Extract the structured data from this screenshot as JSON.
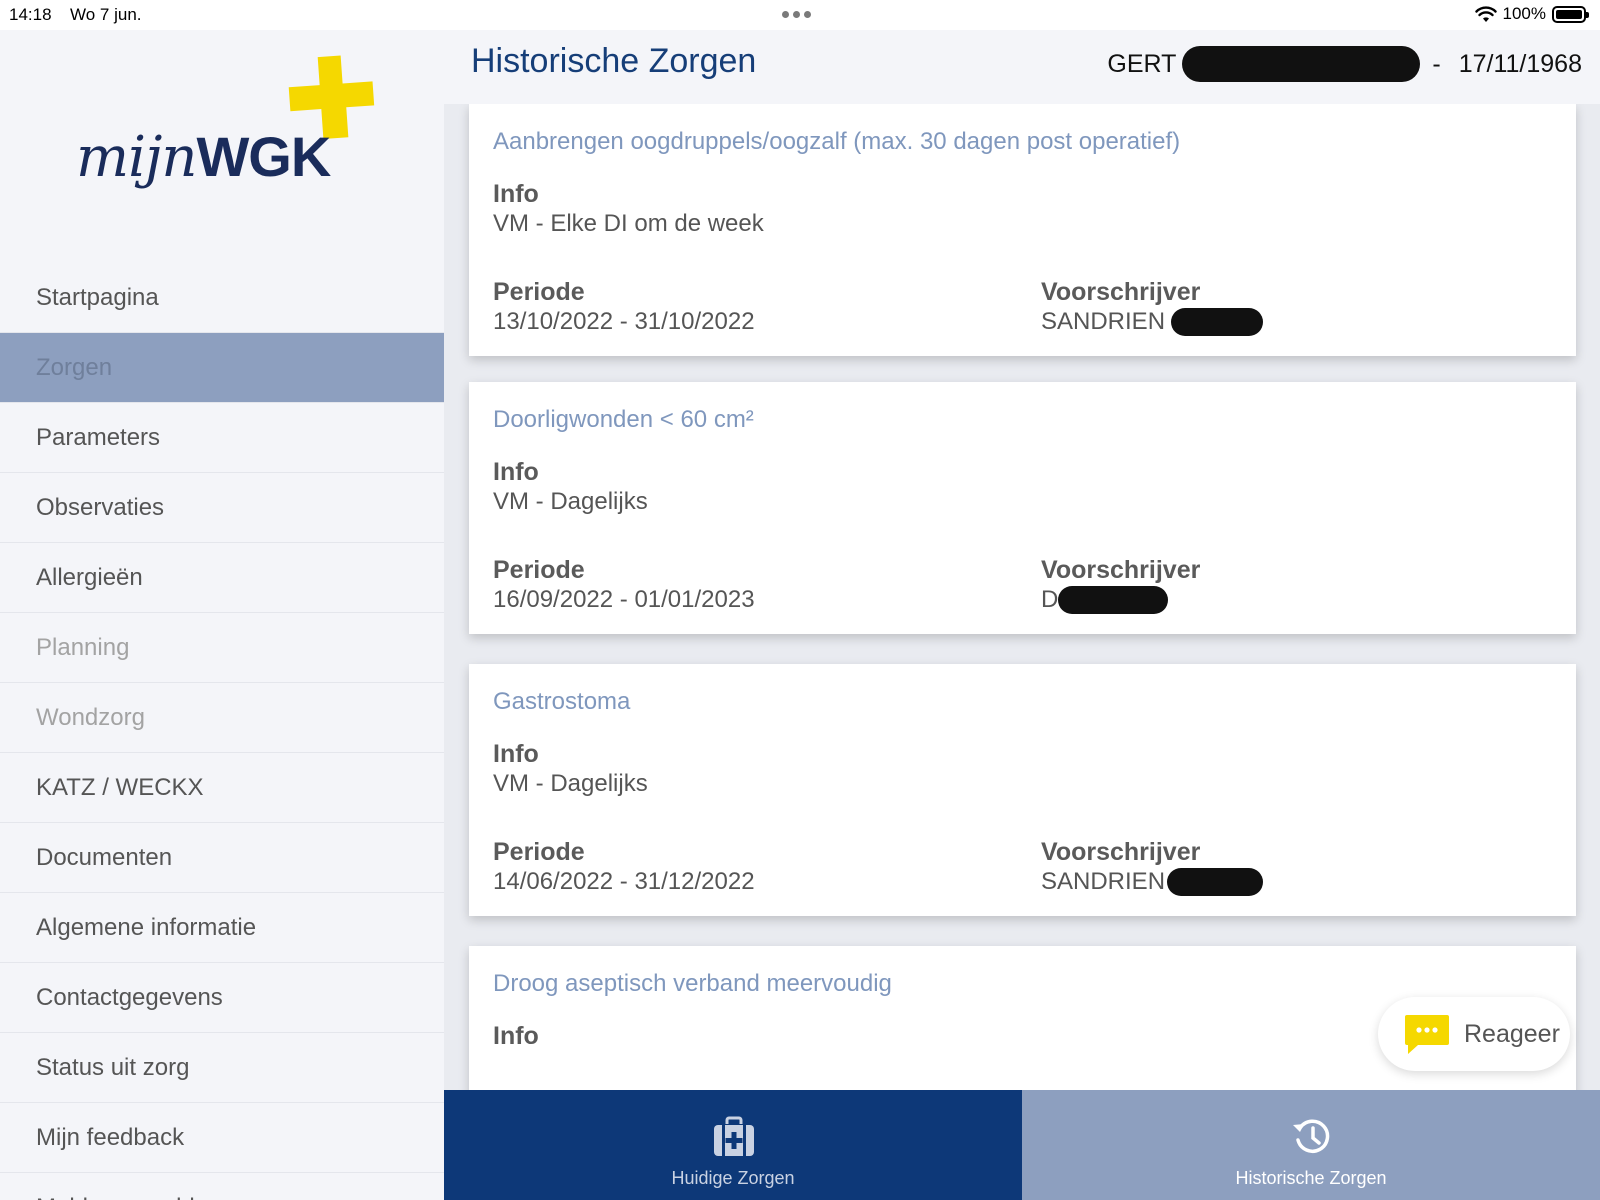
{
  "status_bar": {
    "time": "14:18",
    "date": "Wo 7 jun.",
    "battery": "100%"
  },
  "logo": {
    "part1": "mijn",
    "part2": "WGK",
    "cross_color": "#f5d800"
  },
  "sidebar": {
    "items": [
      {
        "label": "Startpagina",
        "state": "normal"
      },
      {
        "label": "Zorgen",
        "state": "active"
      },
      {
        "label": "Parameters",
        "state": "normal"
      },
      {
        "label": "Observaties",
        "state": "normal"
      },
      {
        "label": "Allergieën",
        "state": "normal"
      },
      {
        "label": "Planning",
        "state": "disabled"
      },
      {
        "label": "Wondzorg",
        "state": "disabled"
      },
      {
        "label": "KATZ / WECKX",
        "state": "normal"
      },
      {
        "label": "Documenten",
        "state": "normal"
      },
      {
        "label": "Algemene informatie",
        "state": "normal"
      },
      {
        "label": "Contactgegevens",
        "state": "normal"
      },
      {
        "label": "Status uit zorg",
        "state": "normal"
      },
      {
        "label": "Mijn feedback",
        "state": "normal"
      },
      {
        "label": "Meld een probleem",
        "state": "normal"
      }
    ]
  },
  "header": {
    "title": "Historische Zorgen",
    "patient_name": "GERT",
    "separator": "-",
    "patient_dob": "17/11/1968"
  },
  "labels": {
    "info": "Info",
    "periode": "Periode",
    "voorschrijver": "Voorschrijver"
  },
  "cards": [
    {
      "title": "Aanbrengen oogdruppels/oogzalf (max. 30 dagen post operatief)",
      "info": "VM - Elke DI om de week",
      "periode": "13/10/2022 - 31/10/2022",
      "voorschrijver": "SANDRIEN"
    },
    {
      "title": "Doorligwonden < 60 cm²",
      "info": "VM - Dagelijks",
      "periode": "16/09/2022 - 01/01/2023",
      "voorschrijver": "D"
    },
    {
      "title": "Gastrostoma",
      "info": "VM - Dagelijks",
      "periode": "14/06/2022 - 31/12/2022",
      "voorschrijver": "SANDRIEN"
    },
    {
      "title": "Droog aseptisch verband meervoudig"
    }
  ],
  "reply_button": {
    "label": "Reageer",
    "icon": "chat-bubble-icon",
    "icon_color": "#f5d800"
  },
  "tabs": [
    {
      "label": "Huidige Zorgen",
      "icon": "medical-kit-icon",
      "color": "#0d3878"
    },
    {
      "label": "Historische Zorgen",
      "icon": "history-icon",
      "color": "#8d9fbf"
    }
  ]
}
